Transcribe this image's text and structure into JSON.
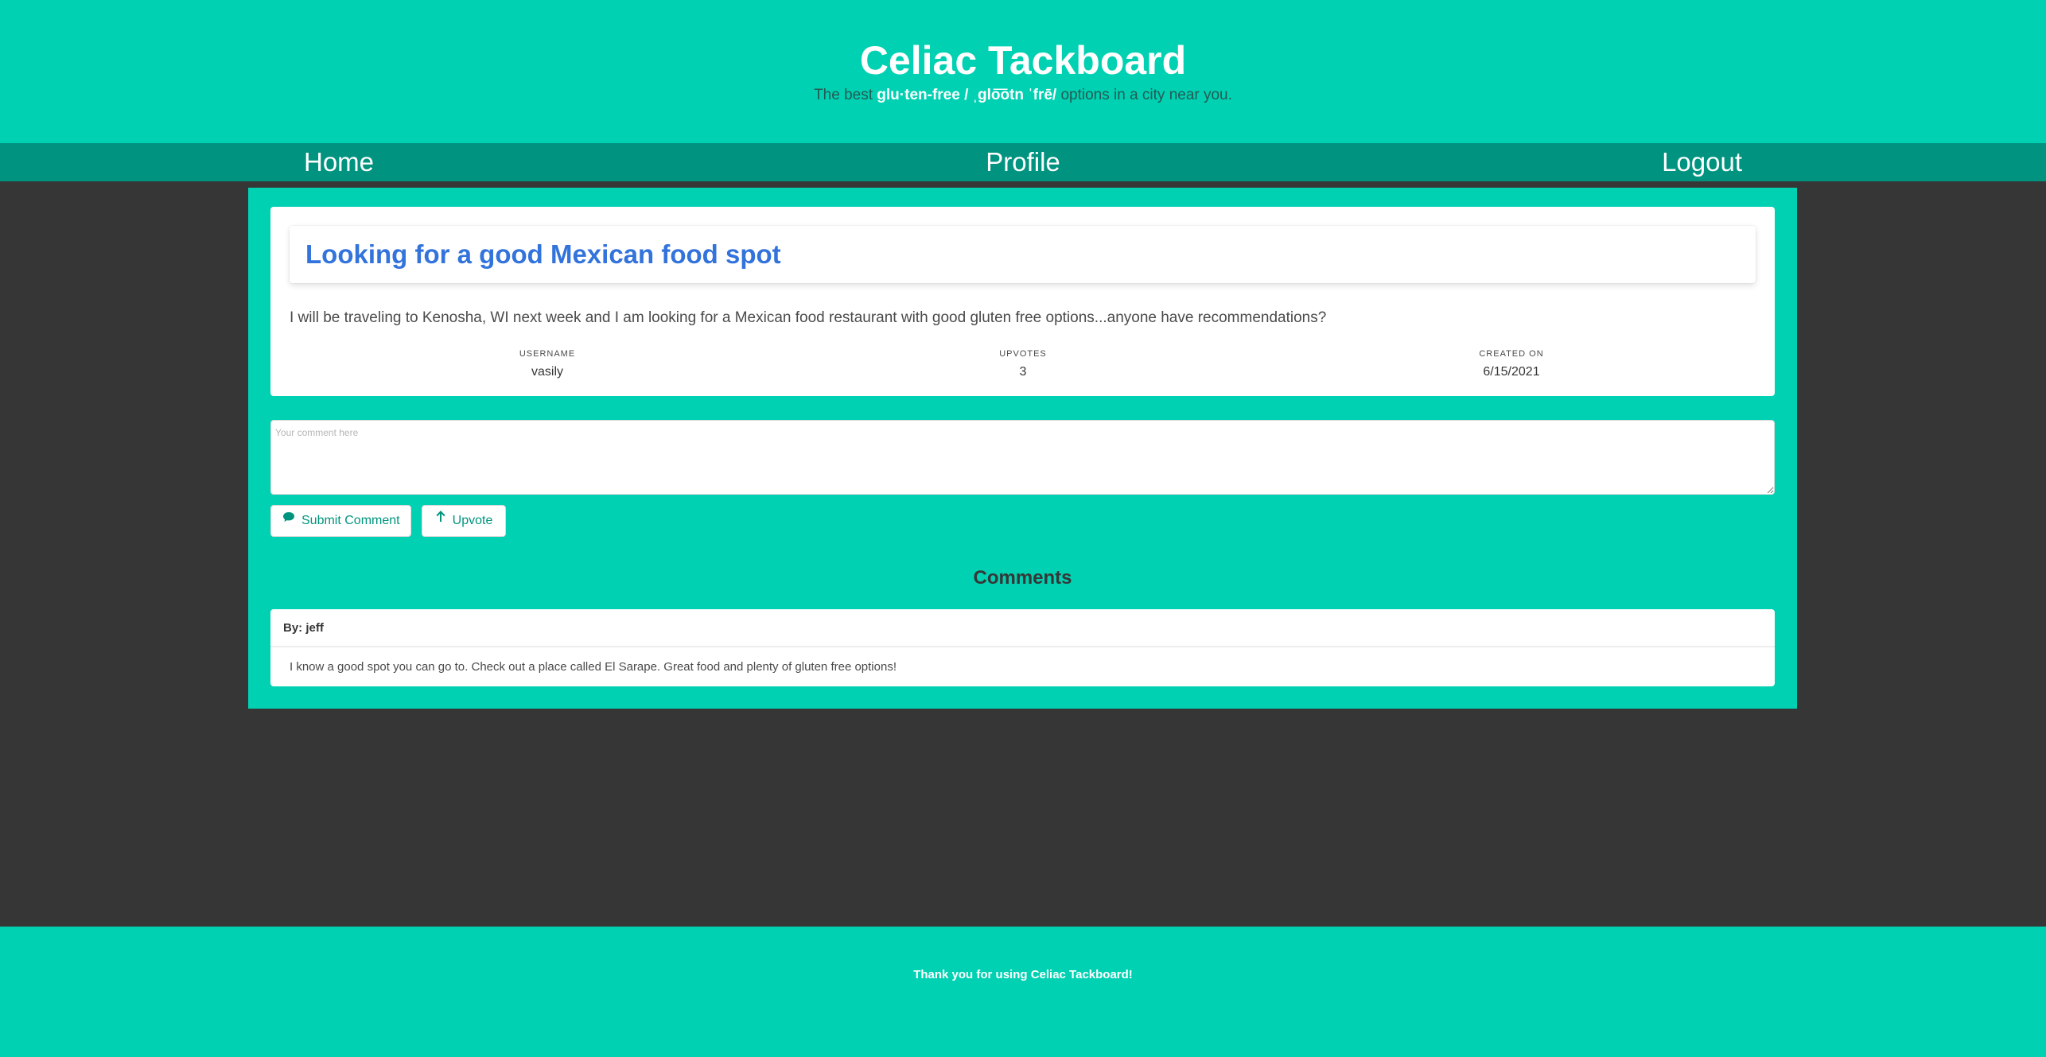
{
  "header": {
    "title": "Celiac Tackboard",
    "tagline_pre": "The best ",
    "tagline_bold": "glu·ten-free / ˌɡlo͞otn ˈfrē/",
    "tagline_post": " options in a city near you."
  },
  "nav": {
    "home": "Home",
    "profile": "Profile",
    "logout": "Logout"
  },
  "post": {
    "title": "Looking for a good Mexican food spot",
    "body": "I will be traveling to Kenosha, WI next week and I am looking for a Mexican food restaurant with good gluten free options...anyone have recommendations?",
    "meta": {
      "username_label": "USERNAME",
      "username": "vasily",
      "upvotes_label": "UPVOTES",
      "upvotes": "3",
      "created_label": "CREATED ON",
      "created": "6/15/2021"
    }
  },
  "comment_form": {
    "placeholder": "Your comment here",
    "submit_label": "Submit Comment",
    "upvote_label": "Upvote"
  },
  "comments": {
    "heading": "Comments",
    "items": [
      {
        "author": "By: jeff",
        "text": "I know a good spot you can go to. Check out a place called El Sarape. Great food and plenty of gluten free options!"
      }
    ]
  },
  "footer": {
    "text": "Thank you for using Celiac Tackboard!"
  },
  "colors": {
    "primary": "#00d1b2",
    "nav": "#009380",
    "background": "#363636",
    "link": "#3273dc"
  },
  "icons": {
    "submit": "comment-icon",
    "upvote": "arrow-up-icon"
  }
}
